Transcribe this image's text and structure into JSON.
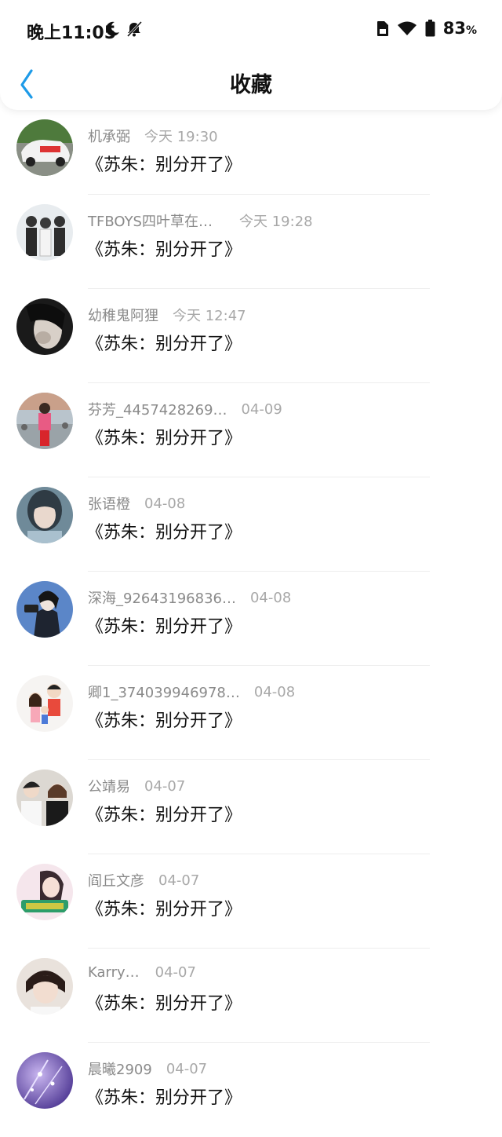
{
  "status_bar": {
    "time": "晚上11:05",
    "battery": "83",
    "battery_unit": "%"
  },
  "nav": {
    "title": "收藏"
  },
  "accent": "#1e9be8",
  "items": [
    {
      "name": "机承弼",
      "time": "今天 19:30",
      "title": "《苏朱：别分开了》"
    },
    {
      "name": "TFBOYS四叶草在…",
      "time": "今天 19:28",
      "title": "《苏朱：别分开了》"
    },
    {
      "name": "幼稚鬼阿狸",
      "time": "今天 12:47",
      "title": "《苏朱：别分开了》"
    },
    {
      "name": "芬芳_4457428269…",
      "time": "04-09",
      "title": "《苏朱：别分开了》"
    },
    {
      "name": "张语橙",
      "time": "04-08",
      "title": "《苏朱：别分开了》"
    },
    {
      "name": "深海_92643196836…",
      "time": "04-08",
      "title": "《苏朱：别分开了》"
    },
    {
      "name": "卿1_374039946978…",
      "time": "04-08",
      "title": "《苏朱：别分开了》"
    },
    {
      "name": "公靖易",
      "time": "04-07",
      "title": "《苏朱：别分开了》"
    },
    {
      "name": "阎丘文彦",
      "time": "04-07",
      "title": "《苏朱：别分开了》"
    },
    {
      "name": "Karry…",
      "time": "04-07",
      "title": "《苏朱：别分开了》"
    },
    {
      "name": "晨曦2909",
      "time": "04-07",
      "title": "《苏朱：别分开了》"
    }
  ]
}
